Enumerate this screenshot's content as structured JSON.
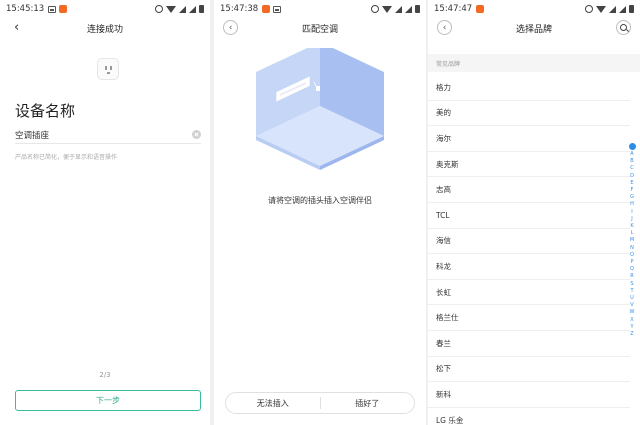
{
  "screen1": {
    "status": {
      "time": "15:45:13"
    },
    "title": "连接成功",
    "device_heading": "设备名称",
    "name_input": {
      "value": "空调插座"
    },
    "hint": "产品名称已简化，便于显示和语音操作",
    "step": "2/3",
    "next_label": "下一步"
  },
  "screen2": {
    "status": {
      "time": "15:47:38"
    },
    "title": "匹配空调",
    "instruction": "请将空调的插头插入空调伴侣",
    "cannot_insert_label": "无法插入",
    "done_label": "插好了"
  },
  "screen3": {
    "status": {
      "time": "15:47:47"
    },
    "title": "选择品牌",
    "section_header": "常见品牌",
    "brands": [
      "格力",
      "美的",
      "海尔",
      "奥克斯",
      "志高",
      "TCL",
      "海信",
      "科龙",
      "长虹",
      "格兰仕",
      "春兰",
      "松下",
      "新科",
      "LG 乐金"
    ],
    "index_letters": [
      "A",
      "B",
      "C",
      "D",
      "E",
      "F",
      "G",
      "H",
      "I",
      "J",
      "K",
      "L",
      "M",
      "N",
      "O",
      "P",
      "Q",
      "R",
      "S",
      "T",
      "U",
      "V",
      "W",
      "X",
      "Y",
      "Z"
    ]
  },
  "colors": {
    "accent_green": "#3cbc9c",
    "index_blue": "#3a8ee6",
    "app_icon_orange": "#f26a23"
  },
  "icons": {
    "back": "back-arrow-icon",
    "search": "search-icon",
    "clear": "clear-icon",
    "plug": "plug-icon"
  }
}
